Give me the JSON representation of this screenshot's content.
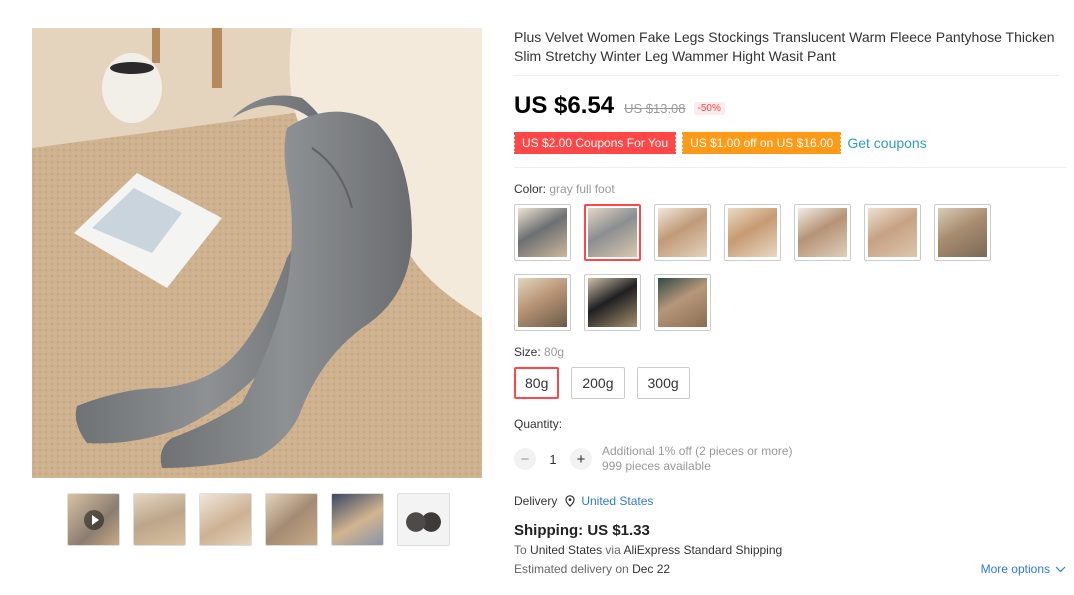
{
  "product": {
    "title": "Plus Velvet Women Fake Legs Stockings Translucent Warm Fleece Pantyhose Thicken Slim Stretchy Winter Leg Wammer Hight Wasit Pant",
    "price": "US $6.54",
    "original_price": "US $13.08",
    "discount": "-50%"
  },
  "coupons": {
    "coupon_1": "US $2.00 Coupons For You",
    "coupon_2": "US $1.00 off on US $16.00",
    "get_label": "Get coupons"
  },
  "color": {
    "label": "Color:",
    "selected": "gray full foot",
    "options_count": 10,
    "selected_index": 1
  },
  "size": {
    "label": "Size:",
    "selected": "80g",
    "options": [
      "80g",
      "200g",
      "300g"
    ]
  },
  "quantity": {
    "label": "Quantity:",
    "minus": "−",
    "plus": "+",
    "value": "1",
    "note_1": "Additional 1% off (2 pieces or more)",
    "note_2": "999 pieces available"
  },
  "delivery": {
    "label": "Delivery",
    "country": "United States",
    "pin_icon": "location-pin-icon"
  },
  "shipping": {
    "title": "Shipping: US $1.33",
    "to_prefix": "To",
    "to_country": "United States",
    "via_text": "via",
    "method": "AliExpress Standard Shipping",
    "eta_prefix": "Estimated delivery on",
    "eta_date": "Dec 22",
    "more_options": "More options",
    "chevron_icon": "chevron-down-icon"
  },
  "gallery": {
    "thumbnail_count": 6,
    "play_icon": "play-icon"
  },
  "colors": {
    "accent_red": "#ff4747",
    "coupon_orange": "#ff9a16",
    "link_blue": "#2e9cc3",
    "delivery_blue": "#2e7bd3"
  }
}
